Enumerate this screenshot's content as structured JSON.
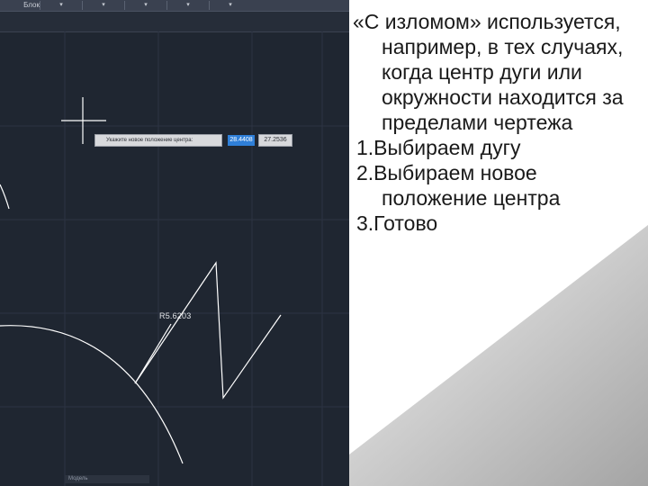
{
  "cad": {
    "toolbar": {
      "dropdown": "Блок"
    },
    "prompt": {
      "label": "Укажите новое положение центра:",
      "x_value": "28.4408",
      "y_value": "27.2536"
    },
    "radius_label": "R5.6203",
    "status_text": "Модель"
  },
  "slide": {
    "items": [
      "«С изломом» используется, например, в тех случаях, когда центр дуги или окружности находится за пределами чертежа",
      "1.Выбираем дугу",
      "2.Выбираем новое положение центра",
      "3.Готово"
    ]
  },
  "colors": {
    "cad_background": "#1f2631",
    "input_highlight": "#2f7fd8",
    "slide_text": "#1a1a1a"
  }
}
